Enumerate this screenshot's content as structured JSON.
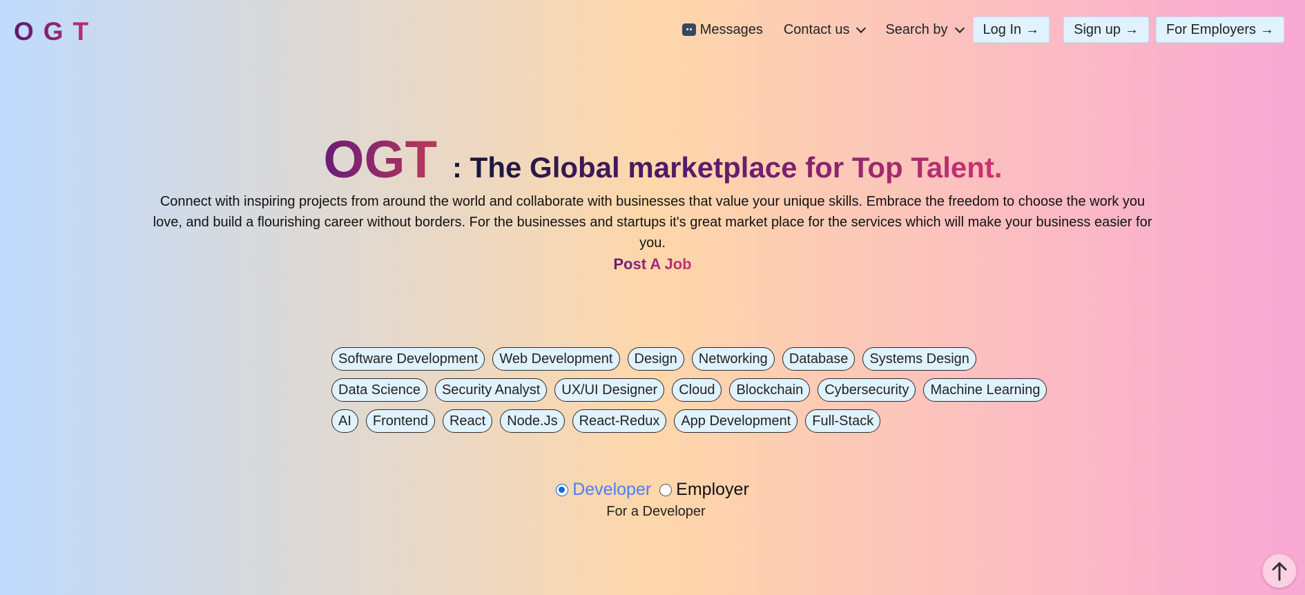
{
  "brand": {
    "logo": "OGT"
  },
  "nav": {
    "messages": {
      "label": "Messages",
      "icon": "message-icon"
    },
    "contact": {
      "label": "Contact us",
      "icon": "chevron-down-icon"
    },
    "search": {
      "label": "Search by",
      "icon": "chevron-down-icon"
    },
    "buttons": [
      {
        "label": "Log In",
        "arrow": "→"
      },
      {
        "label": "Sign up",
        "arrow": "→"
      },
      {
        "label": "For Employers",
        "arrow": "→"
      }
    ]
  },
  "hero": {
    "brand": "OGT",
    "tagline": ": The Global marketplace for Top Talent.",
    "description": "Connect with inspiring projects from around the world and collaborate with businesses that value your unique skills. Embrace the freedom to choose the work you love, and build a flourishing career without borders. For the businesses and startups it's great market place for the services which will make your business easier for you.",
    "cta": "Post A Job"
  },
  "tags": [
    [
      "Software Development",
      "Web Development",
      "Design",
      "Networking",
      "Database",
      "Systems Design"
    ],
    [
      "Data Science",
      "Security Analyst",
      "UX/UI Designer",
      "Cloud",
      "Blockchain",
      "Cybersecurity",
      "Machine Learning"
    ],
    [
      "AI",
      "Frontend",
      "React",
      "Node.Js",
      "React-Redux",
      "App Development",
      "Full-Stack"
    ]
  ],
  "role": {
    "options": [
      {
        "label": "Developer",
        "checked": true
      },
      {
        "label": "Employer",
        "checked": false
      }
    ],
    "subtitle": "For a Developer"
  },
  "scroll_top": {
    "icon": "arrow-up-icon"
  },
  "colors": {
    "bg_left": "#bfdbfe",
    "bg_mid": "#fed7aa",
    "bg_right": "#f9a8d4",
    "pill_bg": "#e0f2fe",
    "brand_start": "#5b1a6e",
    "brand_end": "#c7336e",
    "radio_accent": "#0b6bde",
    "active_label": "#4f7ef0"
  }
}
